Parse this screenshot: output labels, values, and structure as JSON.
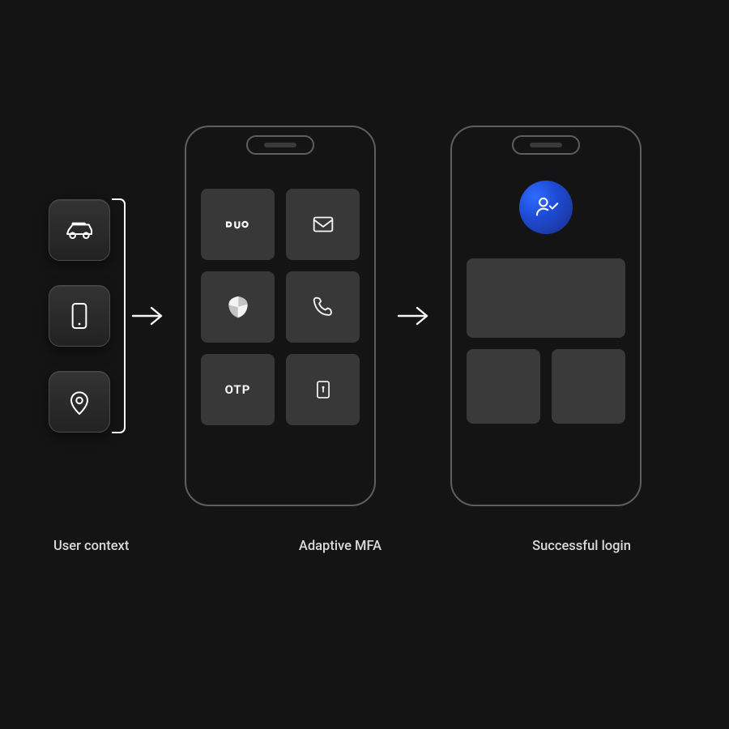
{
  "labels": {
    "user_context": "User context",
    "adaptive_mfa": "Adaptive MFA",
    "successful_login": "Successful login"
  },
  "context_icons": [
    "car-icon",
    "mobile-icon",
    "location-pin-icon"
  ],
  "mfa": {
    "tiles": [
      {
        "name": "duo",
        "kind": "logo"
      },
      {
        "name": "email",
        "kind": "icon"
      },
      {
        "name": "shield",
        "kind": "icon"
      },
      {
        "name": "phone-call",
        "kind": "icon"
      },
      {
        "name": "otp",
        "kind": "text",
        "label": "OTP"
      },
      {
        "name": "keypad-lock",
        "kind": "icon"
      }
    ]
  }
}
